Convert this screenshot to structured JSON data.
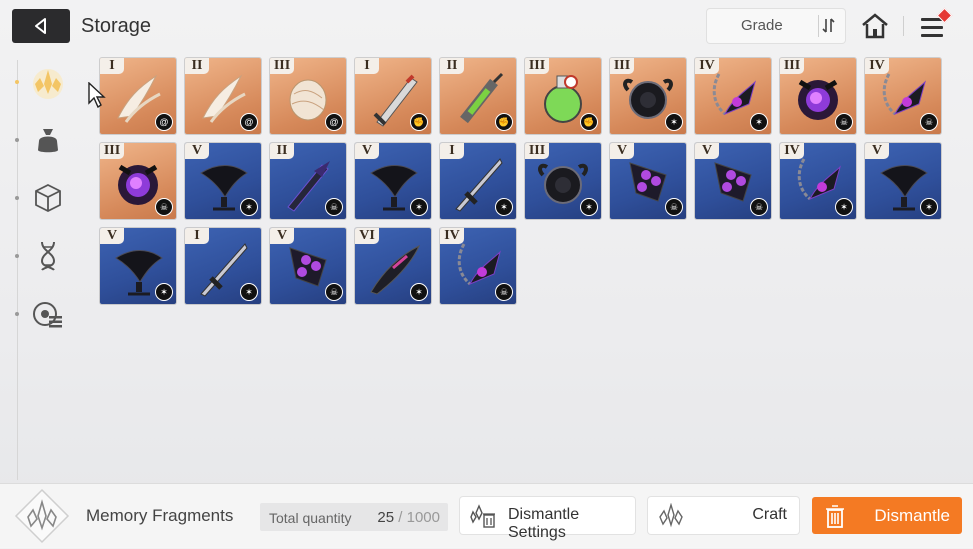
{
  "header": {
    "title": "Storage",
    "sort_label": "Grade"
  },
  "sidebar": {
    "items": [
      {
        "name": "memory-fragments",
        "active": true
      },
      {
        "name": "bag"
      },
      {
        "name": "cube"
      },
      {
        "name": "dna"
      },
      {
        "name": "chip"
      }
    ]
  },
  "grid": {
    "items": [
      {
        "grade": "I",
        "color": "orange",
        "badge": "swirl",
        "art": "claw"
      },
      {
        "grade": "II",
        "color": "orange",
        "badge": "swirl",
        "art": "claw"
      },
      {
        "grade": "III",
        "color": "orange",
        "badge": "swirl",
        "art": "shell"
      },
      {
        "grade": "I",
        "color": "orange",
        "badge": "fist",
        "art": "sword"
      },
      {
        "grade": "II",
        "color": "orange",
        "badge": "fist",
        "art": "syringe"
      },
      {
        "grade": "III",
        "color": "orange",
        "badge": "fist",
        "art": "potion"
      },
      {
        "grade": "III",
        "color": "orange",
        "badge": "claw",
        "art": "ring"
      },
      {
        "grade": "IV",
        "color": "orange",
        "badge": "claw",
        "art": "chain"
      },
      {
        "grade": "III",
        "color": "orange",
        "badge": "skull",
        "art": "orb"
      },
      {
        "grade": "IV",
        "color": "orange",
        "badge": "skull",
        "art": "chain"
      },
      {
        "grade": "III",
        "color": "orange",
        "badge": "skull",
        "art": "orb"
      },
      {
        "grade": "V",
        "color": "blue",
        "badge": "claw",
        "art": "raven"
      },
      {
        "grade": "II",
        "color": "blue",
        "badge": "skull",
        "art": "blade"
      },
      {
        "grade": "V",
        "color": "blue",
        "badge": "claw",
        "art": "raven"
      },
      {
        "grade": "I",
        "color": "blue",
        "badge": "claw",
        "art": "dagger"
      },
      {
        "grade": "III",
        "color": "blue",
        "badge": "claw",
        "art": "ring"
      },
      {
        "grade": "V",
        "color": "blue",
        "badge": "skull",
        "art": "gems"
      },
      {
        "grade": "V",
        "color": "blue",
        "badge": "skull",
        "art": "gems"
      },
      {
        "grade": "IV",
        "color": "blue",
        "badge": "claw",
        "art": "chain"
      },
      {
        "grade": "V",
        "color": "blue",
        "badge": "claw",
        "art": "raven"
      },
      {
        "grade": "V",
        "color": "blue",
        "badge": "claw",
        "art": "raven"
      },
      {
        "grade": "I",
        "color": "blue",
        "badge": "claw",
        "art": "dagger"
      },
      {
        "grade": "V",
        "color": "blue",
        "badge": "skull",
        "art": "gems"
      },
      {
        "grade": "VI",
        "color": "blue",
        "badge": "claw",
        "art": "feather"
      },
      {
        "grade": "IV",
        "color": "blue",
        "badge": "skull",
        "art": "chain"
      }
    ]
  },
  "footer": {
    "category_label": "Memory Fragments",
    "total_label": "Total quantity",
    "quantity_current": "25",
    "quantity_separator": "/",
    "quantity_max": "1000",
    "dismantle_settings_label": "Dismantle Settings",
    "craft_label": "Craft",
    "dismantle_label": "Dismantle"
  },
  "colors": {
    "orange_tile": "#d6895a",
    "blue_tile": "#2f4f9a",
    "accent": "#f47a23"
  }
}
